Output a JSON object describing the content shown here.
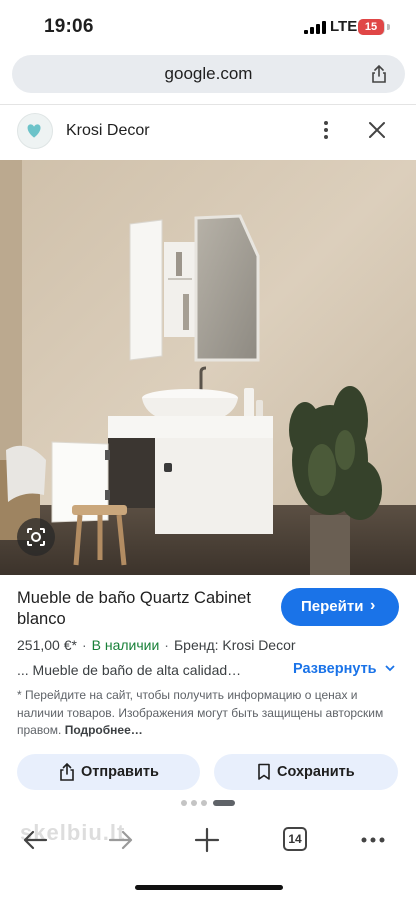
{
  "status_bar": {
    "time": "19:06",
    "network": "LTE",
    "battery": "15"
  },
  "browser": {
    "url": "google.com"
  },
  "site": {
    "name": "Krosi Decor"
  },
  "product": {
    "title": "Mueble de baño Quartz Cabinet blanco",
    "price": "251,00 €*",
    "availability": "В наличии",
    "brand": "Бренд: Krosi Decor",
    "description": "... Mueble de baño de alta calidad…",
    "expand_label": "Развернуть",
    "note": "* Перейдите на сайт, чтобы получить информацию о ценах и наличии товаров. Изображения могут быть защищены авторским правом.",
    "more_link": "Подробнее…"
  },
  "buttons": {
    "go": "Перейти",
    "send": "Отправить",
    "save": "Сохранить"
  },
  "bottom_bar": {
    "tabs_count": "14",
    "watermark": "skelbiu.lt"
  },
  "colors": {
    "accent": "#1a73e8",
    "stock": "#188038",
    "chip_bg": "#e8effc"
  },
  "icons": [
    "share-icon",
    "heart-logo-icon",
    "more-vert-icon",
    "close-icon",
    "lens-icon",
    "chevron-right-icon",
    "chevron-down-icon",
    "bookmark-icon",
    "back-icon",
    "forward-icon",
    "plus-icon",
    "tabs-icon",
    "more-horiz-icon"
  ]
}
